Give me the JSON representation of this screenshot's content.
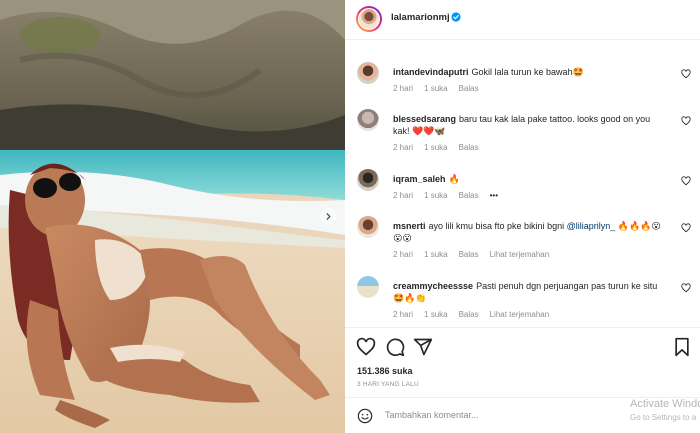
{
  "post": {
    "username": "lalamarionmj",
    "likes": "151.386 suka",
    "time_ago": "3 HARI YANG LALU",
    "add_comment_placeholder": "Tambahkan komentar..."
  },
  "comments": [
    {
      "user": "intandevindaputri",
      "text": "Gokil lala turun ke bawah🤩",
      "meta": [
        "2 hari",
        "1 suka",
        "Balas"
      ]
    },
    {
      "user": "blessedsarang",
      "text": "baru tau kak lala pake tattoo. looks good on you kak! ❤️❤️🦋",
      "meta": [
        "2 hari",
        "1 suka",
        "Balas"
      ]
    },
    {
      "user": "iqram_saleh",
      "text": "🔥",
      "meta": [
        "2 hari",
        "1 suka",
        "Balas",
        "•••"
      ]
    },
    {
      "user": "msnerti",
      "text_before": "ayo lili kmu bisa fto pke bikini bgni ",
      "mention": "@liliaprilyn_",
      "text_after": " 🔥🔥🔥😮😮😮",
      "meta": [
        "2 hari",
        "1 suka",
        "Balas",
        "Lihat terjemahan"
      ]
    },
    {
      "user": "creammycheessse",
      "text": "Pasti penuh dgn perjuangan pas turun ke situ 🤩🔥👏",
      "meta": [
        "2 hari",
        "1 suka",
        "Balas",
        "Lihat terjemahan"
      ]
    }
  ],
  "watermark": {
    "title": "Activate Windo",
    "subtitle": "Go to Settings to a"
  },
  "icons": {
    "verified": "verified-badge-icon",
    "heart": "heart-icon",
    "comment": "comment-icon",
    "share": "share-icon",
    "save": "bookmark-icon",
    "emoji": "emoji-icon",
    "next": "chevron-right-icon"
  },
  "colors": {
    "verified_blue": "#0095f6",
    "meta_gray": "#8e8e8e",
    "mention_blue": "#00376b"
  }
}
